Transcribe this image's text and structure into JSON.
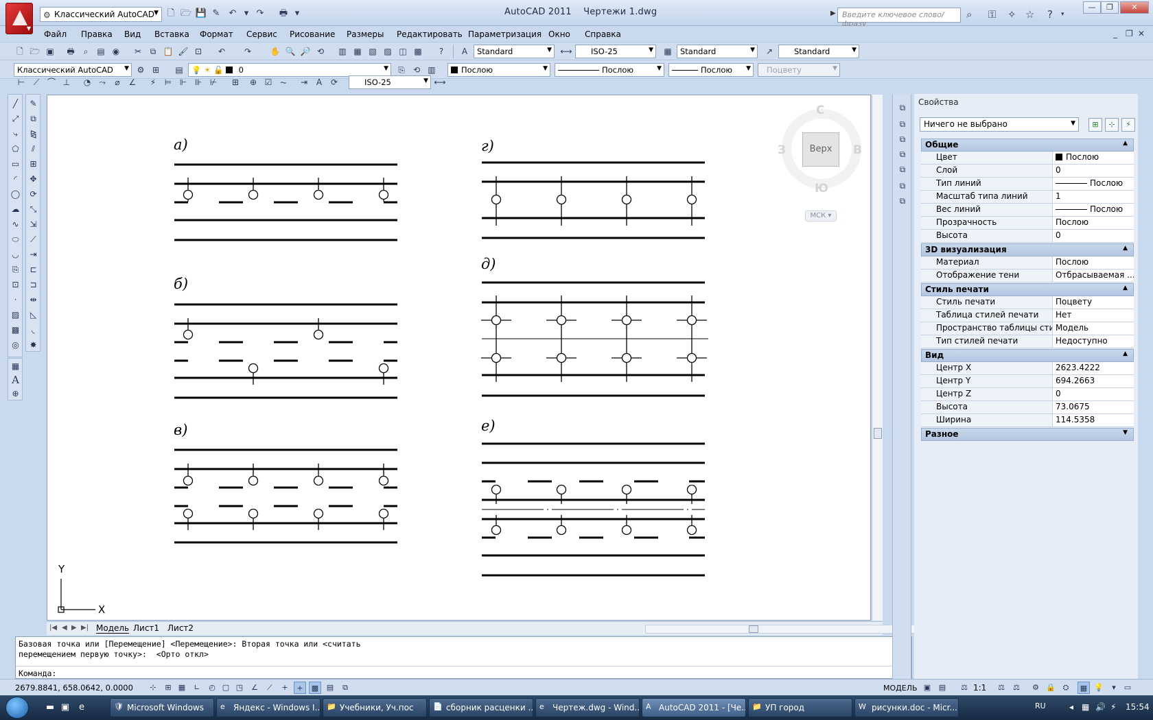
{
  "window": {
    "title": "AutoCAD 2011",
    "document": "Чертежи 1.dwg",
    "workspace": "Классический AutoCAD",
    "search_placeholder": "Введите ключевое слово/фразу"
  },
  "menu": [
    "Файл",
    "Правка",
    "Вид",
    "Вставка",
    "Формат",
    "Сервис",
    "Рисование",
    "Размеры",
    "Редактировать",
    "Параметризация",
    "Окно",
    "Справка"
  ],
  "styles_toolbar": {
    "text_style": "Standard",
    "dim_style": "ISO-25",
    "table_style": "Standard",
    "multileader_style": "Standard"
  },
  "layers_toolbar": {
    "workspace": "Классический AutoCAD",
    "layer": "0",
    "color": "Послою",
    "linetype": "Послою",
    "lineweight": "Послою",
    "plotstyle": "Поцвету"
  },
  "dim_toolbar": {
    "dim_style": "ISO-25"
  },
  "drawing": {
    "panels": [
      "а)",
      "б)",
      "в)",
      "г)",
      "д)",
      "е)"
    ]
  },
  "viewcube": {
    "face": "Верх",
    "north": "С",
    "south": "Ю",
    "east": "В",
    "west": "З",
    "ucs": "МСК"
  },
  "ucs_icon": {
    "x_label": "X",
    "y_label": "Y"
  },
  "layout_tabs": [
    "Модель",
    "Лист1",
    "Лист2"
  ],
  "command_line": {
    "history_line1": "Базовая точка или [Перемещение] <Перемещение>: Вторая точка или <считать",
    "history_line2": "перемещением первую точку>:  <Орто откл>",
    "prompt": "Команда:"
  },
  "statusbar": {
    "coords": "2679.8841, 658.0642, 0.0000",
    "space": "МОДЕЛЬ",
    "annotation_scale": "1:1"
  },
  "properties": {
    "title": "Свойства",
    "selection": "Ничего не выбрано",
    "categories": [
      {
        "name": "Общие",
        "rows": [
          {
            "name": "Цвет",
            "value": "Послою",
            "kind": "color"
          },
          {
            "name": "Слой",
            "value": "0"
          },
          {
            "name": "Тип линий",
            "value": "Послою",
            "kind": "line"
          },
          {
            "name": "Масштаб типа линий",
            "value": "1"
          },
          {
            "name": "Вес линий",
            "value": "Послою",
            "kind": "line"
          },
          {
            "name": "Прозрачность",
            "value": "Послою"
          },
          {
            "name": "Высота",
            "value": "0"
          }
        ]
      },
      {
        "name": "3D визуализация",
        "rows": [
          {
            "name": "Материал",
            "value": "Послою"
          },
          {
            "name": "Отображение тени",
            "value": "Отбрасываемая ..."
          }
        ]
      },
      {
        "name": "Стиль печати",
        "rows": [
          {
            "name": "Стиль печати",
            "value": "Поцвету"
          },
          {
            "name": "Таблица стилей печати",
            "value": "Нет"
          },
          {
            "name": "Пространство таблицы стилей...",
            "value": "Модель"
          },
          {
            "name": "Тип стилей печати",
            "value": "Недоступно"
          }
        ]
      },
      {
        "name": "Вид",
        "rows": [
          {
            "name": "Центр X",
            "value": "2623.4222"
          },
          {
            "name": "Центр Y",
            "value": "694.2663"
          },
          {
            "name": "Центр Z",
            "value": "0"
          },
          {
            "name": "Высота",
            "value": "73.0675"
          },
          {
            "name": "Ширина",
            "value": "114.5358"
          }
        ]
      },
      {
        "name": "Разное",
        "rows": [],
        "collapsed": true
      }
    ]
  },
  "taskbar": {
    "items": [
      "Microsoft Windows",
      "Яндекс - Windows I...",
      "Учебники, Уч.пос",
      "сборник расценки ...",
      "Чертеж.dwg - Wind...",
      "AutoCAD 2011 - [Че...",
      "УП город",
      "рисунки.doc - Micr..."
    ],
    "active_index": 5,
    "lang": "RU",
    "clock": "15:54"
  }
}
